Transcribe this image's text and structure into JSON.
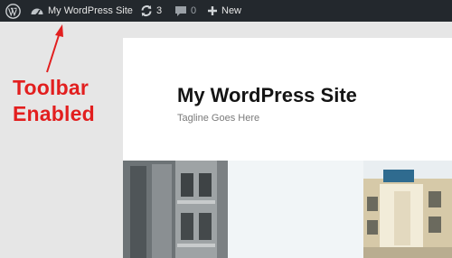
{
  "toolbar": {
    "site_name": "My WordPress Site",
    "updates_count": "3",
    "comments_count": "0",
    "new_label": "New"
  },
  "site": {
    "title": "My WordPress Site",
    "tagline": "Tagline Goes Here"
  },
  "annotation": {
    "line1": "Toolbar",
    "line2": "Enabled",
    "color": "#e21f1f"
  },
  "icons": {
    "wp_logo": "wordpress-logo-icon",
    "dashboard": "dashboard-icon",
    "updates": "updates-icon",
    "comments": "comment-bubble-icon",
    "new": "plus-icon"
  }
}
